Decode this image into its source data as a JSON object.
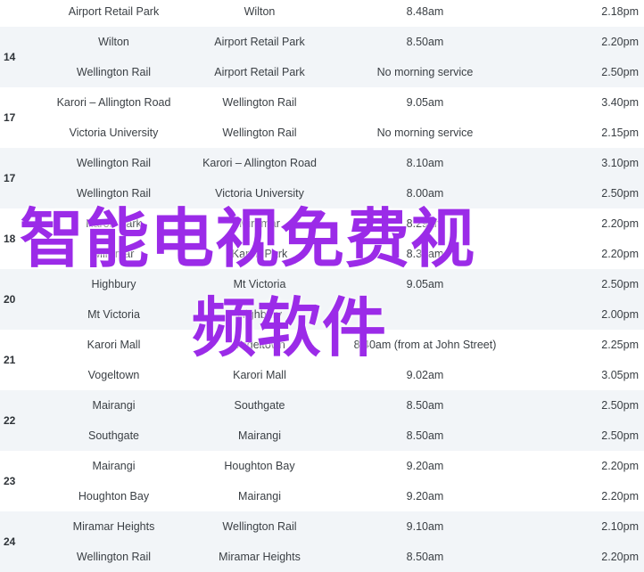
{
  "timetable": {
    "groups": [
      {
        "route": "",
        "rows": [
          {
            "from": "Airport Retail Park",
            "to": "Wilton",
            "morning": "8.48am",
            "return": "2.18pm"
          }
        ]
      },
      {
        "route": "14",
        "rows": [
          {
            "from": "Wilton",
            "to": "Airport Retail Park",
            "morning": "8.50am",
            "return": "2.20pm"
          },
          {
            "from": "Wellington Rail",
            "to": "Airport Retail Park",
            "morning": "No morning service",
            "return": "2.50pm"
          }
        ]
      },
      {
        "route": "17",
        "rows": [
          {
            "from": "Karori – Allington Road",
            "to": "Wellington Rail",
            "morning": "9.05am",
            "return": "3.40pm"
          },
          {
            "from": "Victoria University",
            "to": "Wellington Rail",
            "morning": "No morning service",
            "return": "2.15pm"
          }
        ]
      },
      {
        "route": "17",
        "rows": [
          {
            "from": "Wellington Rail",
            "to": "Karori – Allington Road",
            "morning": "8.10am",
            "return": "3.10pm"
          },
          {
            "from": "Wellington Rail",
            "to": "Victoria University",
            "morning": "8.00am",
            "return": "2.50pm"
          }
        ]
      },
      {
        "route": "18",
        "rows": [
          {
            "from": "Karori Park",
            "to": "Miramar",
            "morning": "8.29am",
            "return": "2.20pm"
          },
          {
            "from": "Miramar",
            "to": "Karori Park",
            "morning": "8.30am",
            "return": "2.20pm"
          }
        ]
      },
      {
        "route": "20",
        "rows": [
          {
            "from": "Highbury",
            "to": "Mt Victoria",
            "morning": "9.05am",
            "return": "2.50pm"
          },
          {
            "from": "Mt Victoria",
            "to": "Highbury",
            "morning": "",
            "return": "2.00pm"
          }
        ]
      },
      {
        "route": "21",
        "rows": [
          {
            "from": "Karori Mall",
            "to": "Vogeltown",
            "morning": "8.40am (from at John Street)",
            "return": "2.25pm"
          },
          {
            "from": "Vogeltown",
            "to": "Karori Mall",
            "morning": "9.02am",
            "return": "3.05pm"
          }
        ]
      },
      {
        "route": "22",
        "rows": [
          {
            "from": "Mairangi",
            "to": "Southgate",
            "morning": "8.50am",
            "return": "2.50pm"
          },
          {
            "from": "Southgate",
            "to": "Mairangi",
            "morning": "8.50am",
            "return": "2.50pm"
          }
        ]
      },
      {
        "route": "23",
        "rows": [
          {
            "from": "Mairangi",
            "to": "Houghton Bay",
            "morning": "9.20am",
            "return": "2.20pm"
          },
          {
            "from": "Houghton Bay",
            "to": "Mairangi",
            "morning": "9.20am",
            "return": "2.20pm"
          }
        ]
      },
      {
        "route": "24",
        "rows": [
          {
            "from": "Miramar Heights",
            "to": "Wellington Rail",
            "morning": "9.10am",
            "return": "2.10pm"
          },
          {
            "from": "Wellington Rail",
            "to": "Miramar Heights",
            "morning": "8.50am",
            "return": "2.20pm"
          }
        ]
      }
    ]
  },
  "overlay": {
    "line1": "智能电视免费视",
    "line2": "频软件"
  },
  "colors": {
    "shade": "#f2f5f8",
    "text": "#3a3f44",
    "overlay": "#9b2be8"
  }
}
